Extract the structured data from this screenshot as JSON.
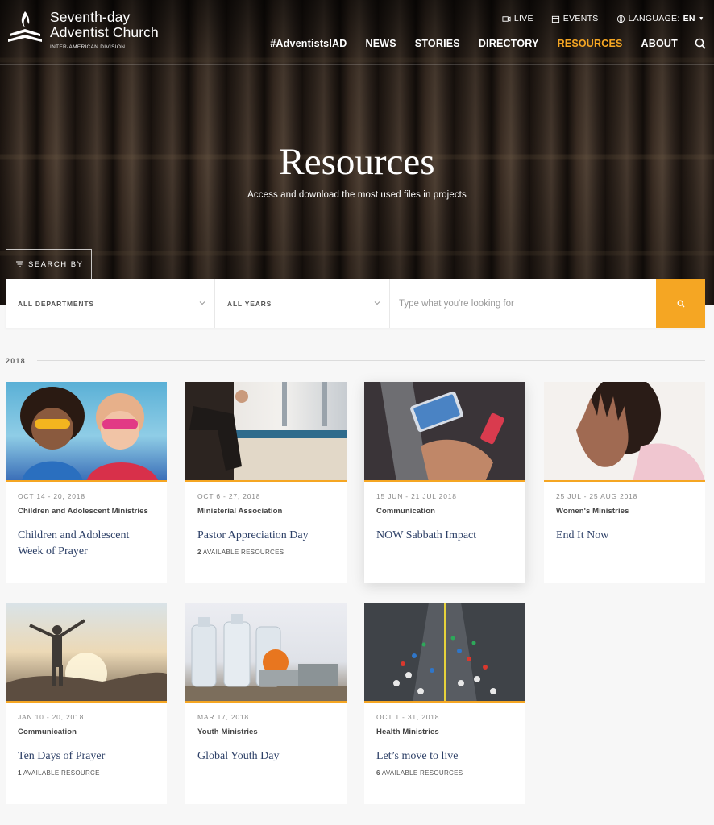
{
  "brand": {
    "line1": "Seventh-day",
    "line2": "Adventist Church",
    "sub": "INTER-AMERICAN DIVISION"
  },
  "utility": {
    "live": "LIVE",
    "events": "EVENTS",
    "language_label": "LANGUAGE:",
    "language_value": "EN"
  },
  "nav": {
    "items": [
      "#AdventistsIAD",
      "NEWS",
      "STORIES",
      "DIRECTORY",
      "RESOURCES",
      "ABOUT"
    ],
    "active": "RESOURCES"
  },
  "hero": {
    "title": "Resources",
    "subtitle": "Access and download the most used files in projects"
  },
  "search": {
    "search_by": "SEARCH BY",
    "departments": "ALL DEPARTMENTS",
    "years": "ALL YEARS",
    "placeholder": "Type what you're looking for"
  },
  "year": "2018",
  "cards": [
    {
      "date": "OCT 14 - 20, 2018",
      "dept": "Children and Adolescent Ministries",
      "title": "Children and Adolescent Week of Prayer",
      "avail_count": "",
      "avail_label": "",
      "image": "kids-superheroes"
    },
    {
      "date": "OCT 6 - 27, 2018",
      "dept": "Ministerial Association",
      "title": "Pastor Appreciation Day",
      "avail_count": "2",
      "avail_label": "AVAILABLE RESOURCES",
      "image": "pastor-sitting"
    },
    {
      "date": "15 JUN - 21 JUL 2018",
      "dept": "Communication",
      "title": "NOW Sabbath Impact",
      "avail_count": "",
      "avail_label": "",
      "image": "phones-in-hands"
    },
    {
      "date": "25 JUL - 25 AUG 2018",
      "dept": "Women's Ministries",
      "title": "End It Now",
      "avail_count": "",
      "avail_label": "",
      "image": "raised-hand"
    },
    {
      "date": "JAN 10 - 20, 2018",
      "dept": "Communication",
      "title": "Ten Days of Prayer",
      "avail_count": "1",
      "avail_label": "AVAILABLE RESOURCE",
      "image": "man-sunrise"
    },
    {
      "date": "MAR 17, 2018",
      "dept": "Youth Ministries",
      "title": "Global Youth Day",
      "avail_count": "",
      "avail_label": "",
      "image": "water-bottles-cans"
    },
    {
      "date": "OCT 1 - 31, 2018",
      "dept": "Health Ministries",
      "title": "Let’s move to live",
      "avail_count": "6",
      "avail_label": "AVAILABLE RESOURCES",
      "image": "marathon-runners"
    }
  ],
  "colors": {
    "accent": "#f5a623",
    "title_blue": "#2d4067",
    "background": "#f7f7f7"
  }
}
